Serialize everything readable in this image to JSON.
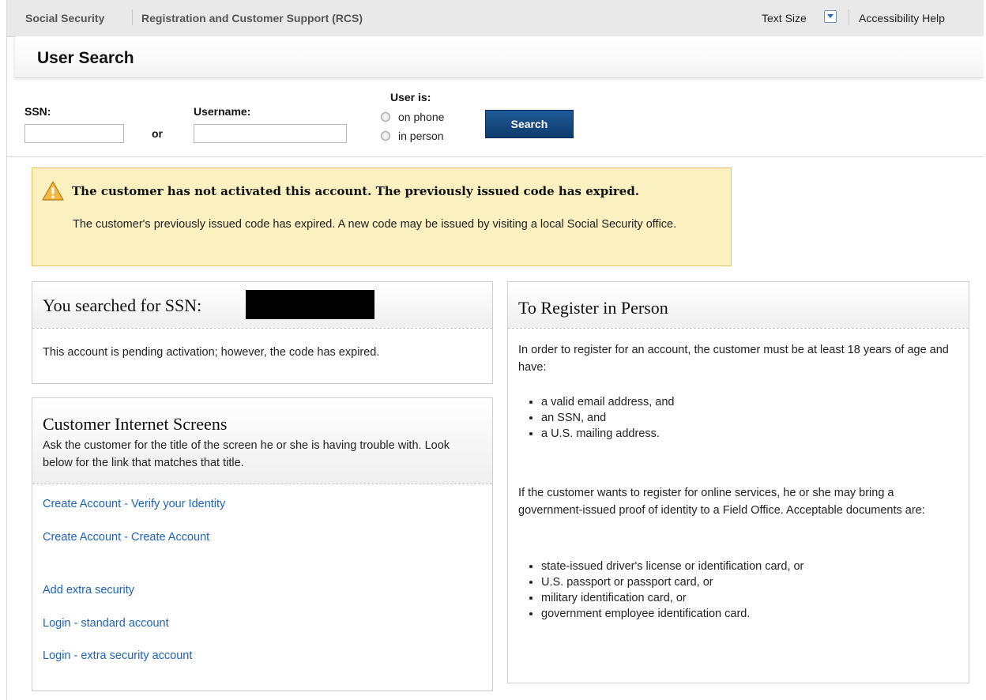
{
  "header": {
    "breadcrumb_1": "Social Security",
    "breadcrumb_2": "Registration and Customer Support (RCS)",
    "text_size": "Text Size",
    "accessibility_help": "Accessibility Help"
  },
  "page": {
    "title": "User Search"
  },
  "search": {
    "ssn_label": "SSN:",
    "ssn_value": "",
    "or_label": "or",
    "username_label": "Username:",
    "username_value": "",
    "user_is_label": "User is:",
    "options": [
      "on phone",
      "in person"
    ],
    "button_label": "Search"
  },
  "alert": {
    "icon": "warning-icon",
    "title": "The customer has not activated this account. The previously issued code has expired.",
    "body": "The customer's previously issued code has expired. A new code may be issued by visiting a local Social Security office."
  },
  "ssn_panel": {
    "heading": "You searched for SSN:",
    "message": "This account is pending activation; however, the code has expired."
  },
  "screens_panel": {
    "heading": "Customer Internet Screens",
    "description": "Ask the customer for the title of the screen he or she is having trouble with. Look below for the link that matches that title.",
    "links": [
      "Create Account - Verify your Identity",
      "Create Account - Create Account",
      "Add extra security",
      "Login - standard account",
      "Login - extra security account"
    ]
  },
  "register_panel": {
    "heading": "To Register in Person",
    "intro": "In order to register for an account, the customer must be at least 18 years of age and have:",
    "requirements": [
      "a valid email address, and",
      "an SSN, and",
      "a U.S. mailing address."
    ],
    "documents_intro": "If the customer wants to register for online services, he or she may bring a government-issued proof of identity to a Field Office. Acceptable documents are:",
    "documents": [
      "state-issued driver's license or identification card, or",
      "U.S. passport or passport card, or",
      "military identification card, or",
      "government employee identification card."
    ]
  },
  "colors": {
    "link": "#1d63b8",
    "search_button": "#14477f",
    "alert_background": "#fbf0c0",
    "alert_border": "#e7c46a"
  }
}
